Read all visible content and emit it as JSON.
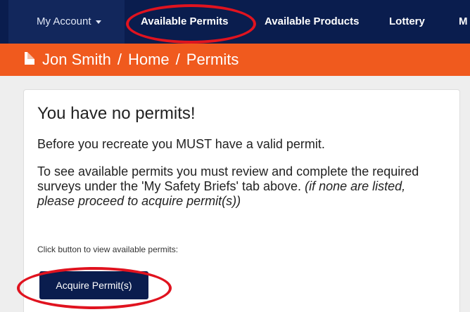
{
  "navbar": {
    "account_label": "My Account",
    "items": [
      "Available Permits",
      "Available Products",
      "Lottery",
      "M"
    ]
  },
  "breadcrumb": {
    "icon": "document-icon",
    "user": "Jon Smith",
    "separator": "/",
    "home": "Home",
    "current": "Permits"
  },
  "panel": {
    "title": "You have no permits!",
    "message": "Before you recreate you MUST have a valid permit.",
    "instructions": "To see available permits you must review and complete the required surveys under the 'My Safety Briefs' tab above.",
    "note": "(if none are listed, please proceed to acquire permit(s))",
    "hint": "Click button to view available permits:",
    "button_label": "Acquire Permit(s)"
  },
  "colors": {
    "navbar": "#0a1d4e",
    "breadcrumb": "#f05a1e",
    "annotation": "#e0131f",
    "button": "#0a1d4e"
  }
}
